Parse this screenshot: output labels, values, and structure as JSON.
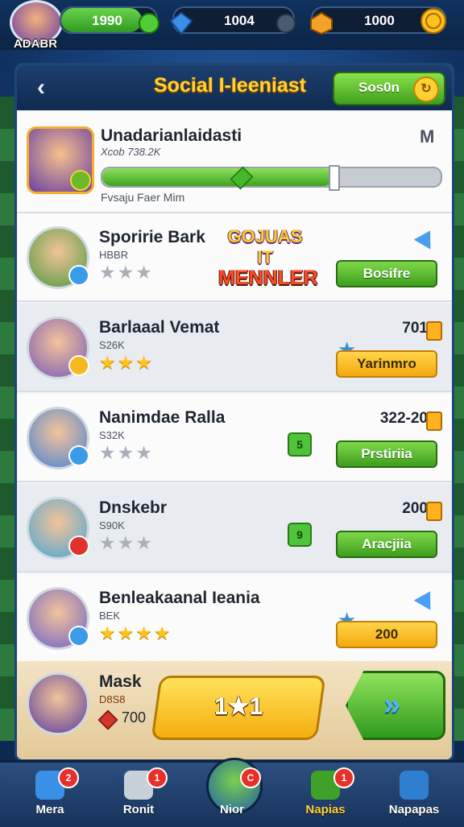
{
  "profile": {
    "name": "ADABR"
  },
  "currencies": [
    {
      "name": "energy",
      "value": "1990",
      "fill": 0.85,
      "color": "#3aae28",
      "icon": "green-gem-icon"
    },
    {
      "name": "gems",
      "value": "1004",
      "fill": 0.0,
      "color": "#2f78d4",
      "icon": "blue-diamond-icon"
    },
    {
      "name": "coins",
      "value": "1000",
      "fill": 0.0,
      "color": "#f4b31f",
      "icon": "coin-icon"
    }
  ],
  "header": {
    "title": "Social I-Ieeniast",
    "button_label": "Sos0n",
    "button_icon": "refresh-coin-icon"
  },
  "player": {
    "name": "Unadarianlaidasti",
    "subtitle": "Xcob 738.2K",
    "footer": "Fvsaju Faer Mim",
    "corner": "M",
    "progress": 0.68
  },
  "event_logo": {
    "top": "GOJUAS IT",
    "bottom": "MENNLER"
  },
  "rows": [
    {
      "name": "Sporirie Bark",
      "sub": "HBBR",
      "stars": 0,
      "score": "",
      "button": "Bosifre",
      "button_style": "green",
      "badge_color": "#3a9be8",
      "avatar_color": "#4f9b3e",
      "tag": "",
      "show_logo": true
    },
    {
      "name": "Barlaaal Vemat",
      "sub": "S26K",
      "stars": 3,
      "score": "701",
      "button": "Yarinmro",
      "button_style": "yellow",
      "badge_color": "#f4b91f",
      "avatar_color": "#7a5ab8",
      "tag": "",
      "show_logo": false
    },
    {
      "name": "Nanimdae Ralla",
      "sub": "S32K",
      "stars": 0,
      "score": "322-20",
      "button": "Prstiriia",
      "button_style": "green",
      "badge_color": "#3a9be8",
      "avatar_color": "#4a84d4",
      "tag": "5",
      "show_logo": false
    },
    {
      "name": "Dnskebr",
      "sub": "S90K",
      "stars": 0,
      "score": "200",
      "button": "Aracjiia",
      "button_style": "green",
      "badge_color": "#e0322a",
      "avatar_color": "#4aa6d4",
      "tag": "9",
      "show_logo": false
    },
    {
      "name": "Benleakaanal Ieania",
      "sub": "BEK",
      "stars": 4,
      "score": "",
      "button": "200",
      "button_style": "yellow",
      "badge_color": "#3a9be8",
      "avatar_color": "#6f63c8",
      "tag": "",
      "show_logo": false
    }
  ],
  "own": {
    "name": "Mask",
    "sub": "D8S8",
    "score": "700",
    "play_label": "1★1",
    "go_icon": "double-arrow-icon"
  },
  "nav": [
    {
      "label": "Mera",
      "icon": "home-icon",
      "badge": "2",
      "active": false
    },
    {
      "label": "Ronit",
      "icon": "database-icon",
      "badge": "1",
      "active": false
    },
    {
      "label": "Nior",
      "icon": "globe-icon",
      "badge": "C",
      "active": false
    },
    {
      "label": "Napias",
      "icon": "target-icon",
      "badge": "1",
      "active": true
    },
    {
      "label": "Napapas",
      "icon": "trophy-icon",
      "badge": "",
      "active": false
    }
  ]
}
